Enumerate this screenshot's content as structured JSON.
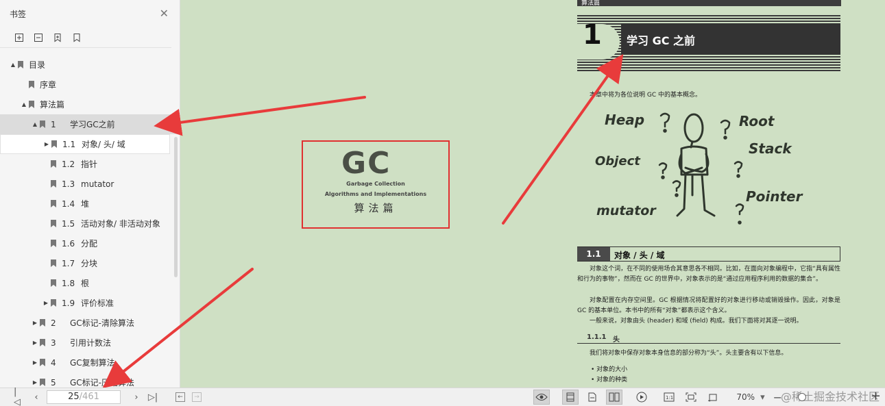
{
  "sidebar": {
    "title": "书签",
    "tools": [
      "expand-all-icon",
      "collapse-all-icon",
      "add-bookmark-icon",
      "bookmark-icon"
    ],
    "items": [
      {
        "num": "",
        "label": "目录",
        "level": 0,
        "caret": "▲"
      },
      {
        "num": "",
        "label": "序章",
        "level": 1,
        "caret": ""
      },
      {
        "num": "",
        "label": "算法篇",
        "level": 1,
        "caret": "▲"
      },
      {
        "num": "1",
        "label": "学习GC之前",
        "level": 2,
        "caret": "▲",
        "selected": true
      },
      {
        "num": "1.1",
        "label": "对象/ 头/ 域",
        "level": 3,
        "caret": "▶",
        "hovered": true
      },
      {
        "num": "1.2",
        "label": "指针",
        "level": 3,
        "caret": ""
      },
      {
        "num": "1.3",
        "label": "mutator",
        "level": 3,
        "caret": ""
      },
      {
        "num": "1.4",
        "label": "堆",
        "level": 3,
        "caret": ""
      },
      {
        "num": "1.5",
        "label": "活动对象/ 非活动对象",
        "level": 3,
        "caret": ""
      },
      {
        "num": "1.6",
        "label": "分配",
        "level": 3,
        "caret": ""
      },
      {
        "num": "1.7",
        "label": "分块",
        "level": 3,
        "caret": ""
      },
      {
        "num": "1.8",
        "label": "根",
        "level": 3,
        "caret": ""
      },
      {
        "num": "1.9",
        "label": "评价标准",
        "level": 3,
        "caret": "▶"
      },
      {
        "num": "2",
        "label": "GC标记-清除算法",
        "level": 2,
        "caret": "▶"
      },
      {
        "num": "3",
        "label": "引用计数法",
        "level": 2,
        "caret": "▶"
      },
      {
        "num": "4",
        "label": "GC复制算法",
        "level": 2,
        "caret": "▶"
      },
      {
        "num": "5",
        "label": "GC标记-压缩算法",
        "level": 2,
        "caret": "▶"
      }
    ]
  },
  "cover": {
    "logo": "GC",
    "sub1": "Garbage Collection",
    "sub2": "Algorithms and Implementations",
    "cn": "算法篇"
  },
  "page": {
    "running_head": "算法篇",
    "chapter_num": "1",
    "chapter_title": "学习 GC 之前",
    "intro": "本章中将为各位说明 GC 中的基本概念。",
    "doodle_words": [
      "Heap",
      "Root",
      "Stack",
      "Object",
      "Pointer",
      "mutator"
    ],
    "section_num": "1.1",
    "section_title": "对象 / 头 / 域",
    "paras": [
      "对象这个词，在不同的使用场合其意思各不相同。比如，在面向对象编程中，它指“具有属性和行为的事物”，然而在 GC 的世界中，对象表示的是“通过应用程序利用的数据的集合”。",
      "对象配置在内存空间里。GC 根据情况将配置好的对象进行移动或销毁操作。因此，对象是 GC 的基本单位。本书中的所有“对象”都表示这个含义。",
      "一般来说，对象由头 (header) 和域 (field) 构成。我们下面将对其逐一说明。"
    ],
    "sub_num": "1.1.1",
    "sub_title": "头",
    "sub_para": "我们将对象中保存对象本身信息的部分称为“头”。头主要含有以下信息。",
    "bullets": [
      "对象的大小",
      "对象的种类"
    ]
  },
  "bottombar": {
    "current_page": "25",
    "total_pages": "/461",
    "zoom": "70%",
    "watermark": "@稀土掘金技术社区"
  },
  "colors": {
    "annotation_red": "#e83b3b",
    "page_bg": "#cfe0c4"
  }
}
